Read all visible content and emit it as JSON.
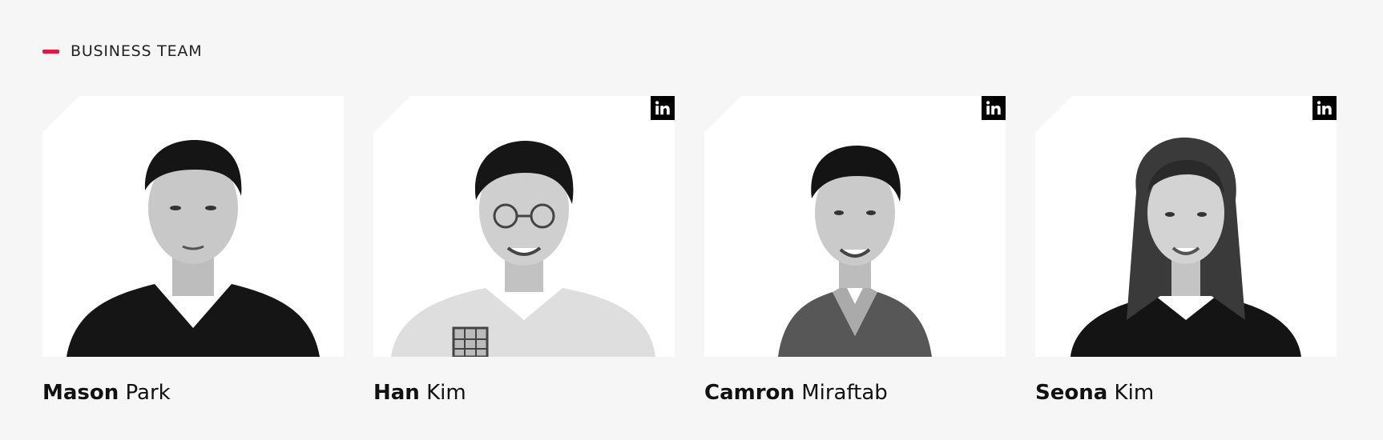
{
  "section": {
    "title": "BUSINESS TEAM",
    "accent_color": "#e5173f"
  },
  "members": [
    {
      "first_name": "Mason",
      "last_name": "Park",
      "photo": "black-and-white portrait, man in black v-neck sweater",
      "linkedin": false
    },
    {
      "first_name": "Han",
      "last_name": "Kim",
      "photo": "black-and-white portrait, smiling man with glasses in light shirt",
      "linkedin": true,
      "linkedin_icon": "linkedin-icon"
    },
    {
      "first_name": "Camron",
      "last_name": "Miraftab",
      "photo": "black-and-white portrait, smiling man in blazer",
      "linkedin": true,
      "linkedin_icon": "linkedin-icon"
    },
    {
      "first_name": "Seona",
      "last_name": "Kim",
      "photo": "black-and-white portrait, smiling woman with long hair",
      "linkedin": true,
      "linkedin_icon": "linkedin-icon"
    }
  ]
}
